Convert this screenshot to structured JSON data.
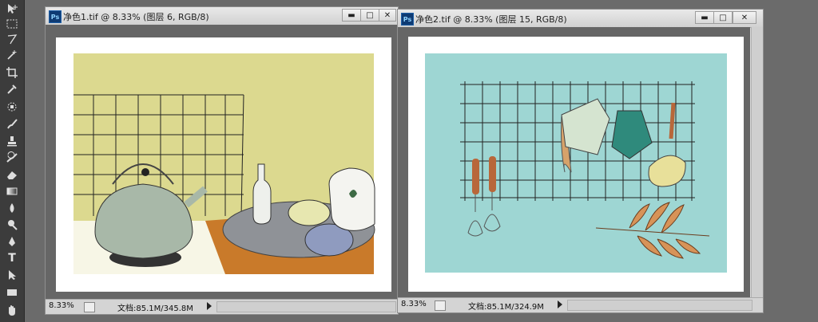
{
  "tools": [
    "move-tool",
    "marquee-tool",
    "lasso-tool",
    "magic-wand-tool",
    "crop-tool",
    "eyedropper-tool",
    "healing-brush-tool",
    "brush-tool",
    "clone-stamp-tool",
    "history-brush-tool",
    "eraser-tool",
    "gradient-tool",
    "blur-tool",
    "dodge-tool",
    "pen-tool",
    "type-tool",
    "path-selection-tool",
    "shape-tool",
    "hand-tool"
  ],
  "type_tool_glyph": "T",
  "windows": [
    {
      "title": "净色1.tif @ 8.33% (图层 6, RGB/8)",
      "ps_badge": "Ps",
      "zoom": "8.33%",
      "doc_size": "文档:85.1M/345.8M"
    },
    {
      "title": "净色2.tif @ 8.33% (图层 15, RGB/8)",
      "ps_badge": "Ps",
      "zoom": "8.33%",
      "doc_size": "文档:85.1M/324.9M"
    }
  ],
  "window_buttons": {
    "minimize": "▬",
    "maximize": "□",
    "close": "✕"
  },
  "colors": {
    "workspace": "#6b6b6b",
    "wall_yellow": "#dcd98f",
    "teal_bg": "#9ed6d3",
    "kettle": "#a8b8a8",
    "tray": "#8f9297",
    "table_orange": "#c97a2a",
    "mug_teal": "#2f8a7c",
    "leaf_orange": "#d79358"
  }
}
